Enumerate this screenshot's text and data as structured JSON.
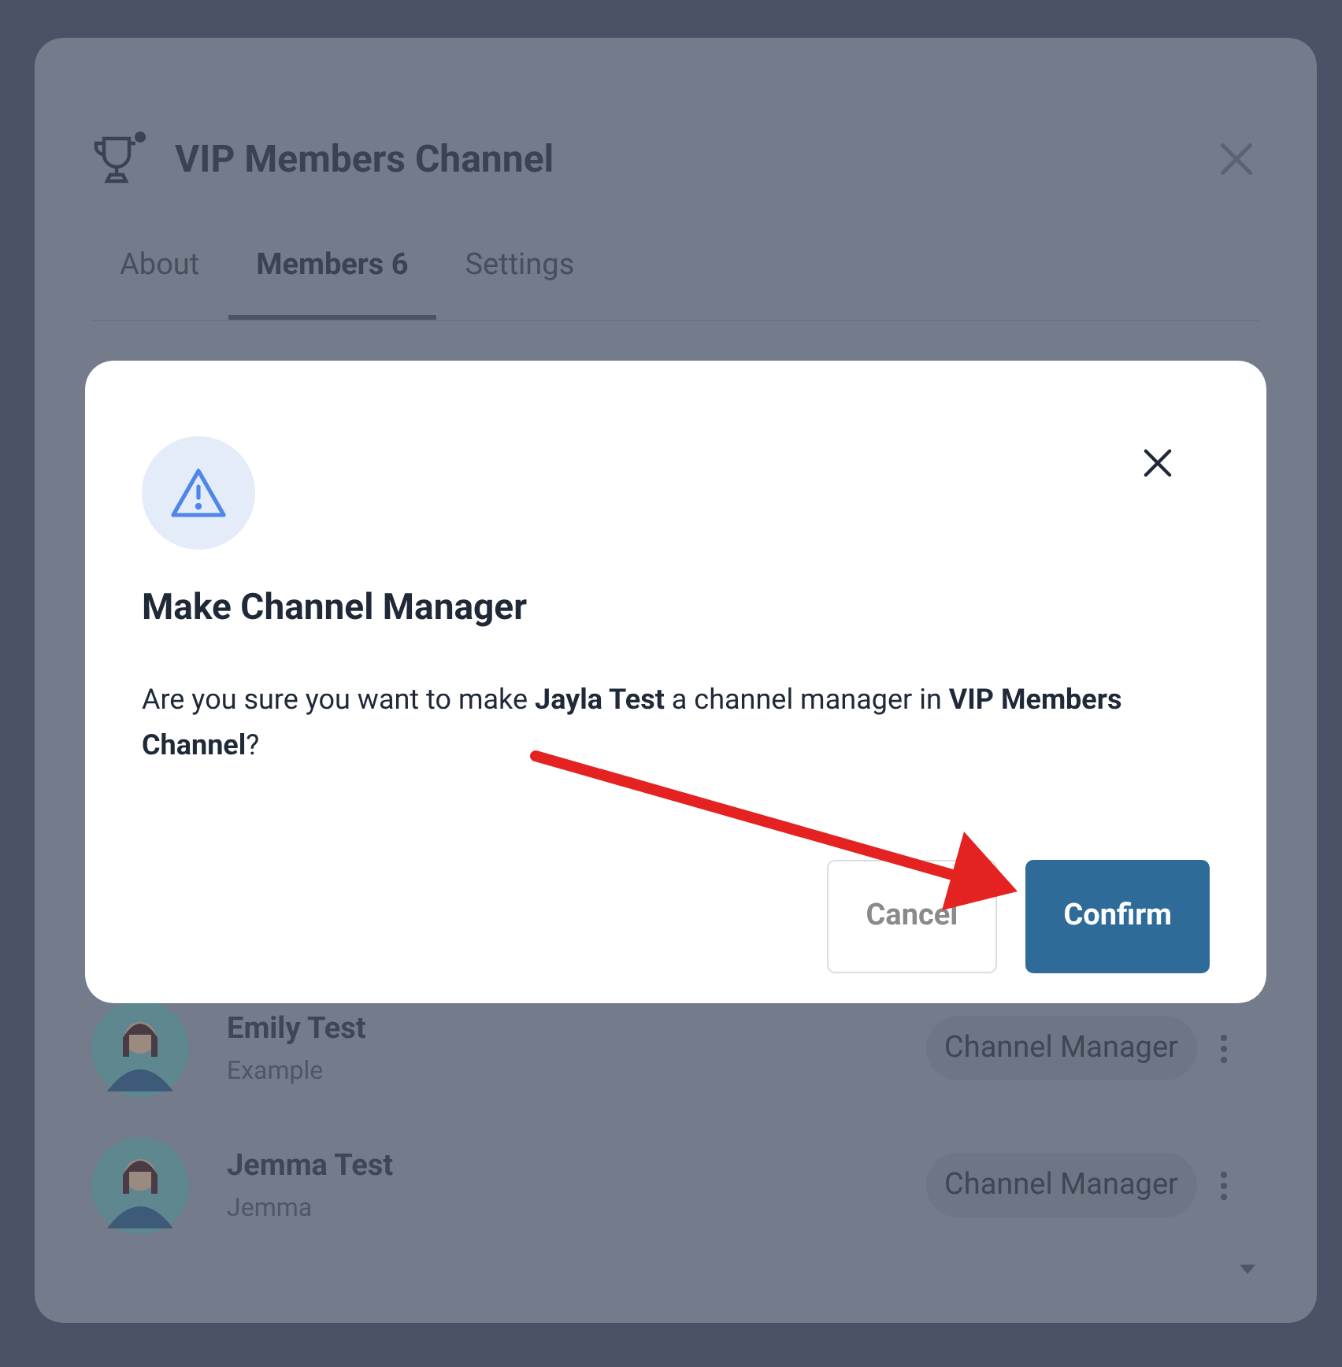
{
  "channel_modal": {
    "title": "VIP Members Channel",
    "tabs": [
      {
        "label": "About",
        "selected": false
      },
      {
        "label": "Members 6",
        "selected": true
      },
      {
        "label": "Settings",
        "selected": false
      }
    ],
    "members": [
      {
        "name": "Emily Test",
        "subtitle": "Example",
        "role": "Channel Manager"
      },
      {
        "name": "Jemma Test",
        "subtitle": "Jemma",
        "role": "Channel Manager"
      }
    ]
  },
  "dialog": {
    "title": "Make Channel Manager",
    "message": "Are you sure you want to make **Jayla Test** a channel manager in **VIP Members Channel**?",
    "buttons": [
      {
        "label": "Cancel",
        "kind": "secondary"
      },
      {
        "label": "Confirm",
        "kind": "primary"
      }
    ]
  }
}
